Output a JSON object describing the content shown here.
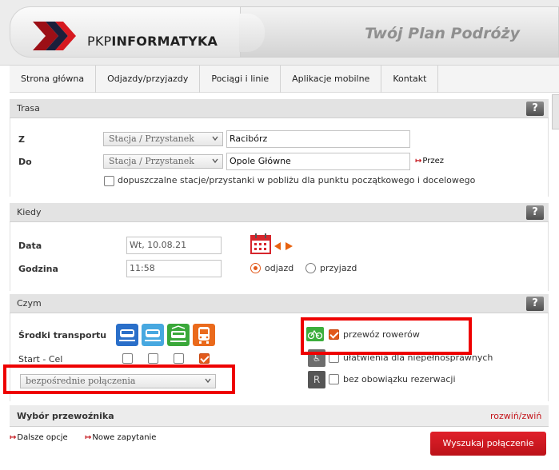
{
  "header": {
    "logo_prefix": "PKP",
    "logo_bold": "INFORMATYKA",
    "app_title": "Twój Plan Podróży"
  },
  "nav": {
    "items": [
      "Strona główna",
      "Odjazdy/przyjazdy",
      "Pociągi i linie",
      "Aplikacje mobilne",
      "Kontakt"
    ]
  },
  "route": {
    "section_title": "Trasa",
    "help": "?",
    "from_label": "Z",
    "to_label": "Do",
    "from_type": "Stacja / Przystanek",
    "to_type": "Stacja / Przystanek",
    "from_value": "Racibórz",
    "to_value": "Opole Główne",
    "via_link": "Przez",
    "nearby_label": "dopuszczalne stacje/przystanki w pobliżu dla punktu początkowego i docelowego"
  },
  "when": {
    "section_title": "Kiedy",
    "help": "?",
    "date_label": "Data",
    "date_value": "Wt, 10.08.21",
    "time_label": "Godzina",
    "time_value": "11:58",
    "departure_label": "odjazd",
    "arrival_label": "przyjazd",
    "selected": "odjazd"
  },
  "how": {
    "section_title": "Czym",
    "help": "?",
    "transport_label": "Środki transportu",
    "start_end_label": "Start - Cel",
    "transport_icons": [
      "train-icon",
      "train-light-icon",
      "train-green-icon",
      "bus-icon"
    ],
    "start_end_checks": [
      false,
      false,
      false,
      true
    ],
    "connections_value": "bezpośrednie połączenia",
    "bike_label": "przewóz rowerów",
    "bike_checked": true,
    "accessible_label": "ułatwienia dla niepełnosprawnych",
    "accessible_checked": false,
    "no_reservation_label": "bez obowiązku rezerwacji",
    "no_reservation_checked": false
  },
  "carrier": {
    "section_title": "Wybór przewoźnika",
    "toggle_link": "rozwiń/zwiń"
  },
  "footer": {
    "more_options": "Dalsze opcje",
    "new_query": "Nowe zapytanie",
    "search_button": "Wyszukaj połączenie"
  },
  "colors": {
    "accent_red": "#c4161c",
    "highlight_red": "#ee0000",
    "checkbox_orange": "#e25a1c"
  }
}
